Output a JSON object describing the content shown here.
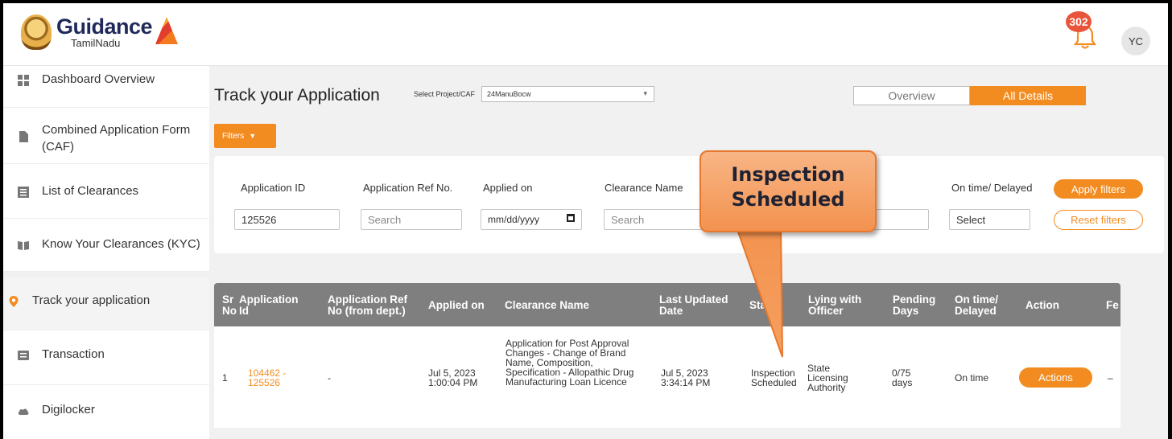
{
  "header": {
    "logo_main": "Guidance",
    "logo_sub": "TamilNadu",
    "notification_count": "302",
    "avatar_initials": "YC"
  },
  "sidebar": {
    "items": [
      {
        "label": "Dashboard Overview",
        "icon": "dashboard-icon"
      },
      {
        "label": "Combined Application Form (CAF)",
        "icon": "document-icon"
      },
      {
        "label": "List of Clearances",
        "icon": "list-icon"
      },
      {
        "label": "Know Your Clearances (KYC)",
        "icon": "book-icon"
      },
      {
        "label": "Track your application",
        "icon": "location-pin-icon"
      },
      {
        "label": "Transaction",
        "icon": "transaction-icon"
      },
      {
        "label": "Digilocker",
        "icon": "cloud-icon"
      }
    ]
  },
  "main": {
    "title": "Track your Application",
    "project_label": "Select Project/CAF",
    "project_value": "24ManuBocw",
    "tabs": {
      "overview": "Overview",
      "all_details": "All Details"
    },
    "filters_label": "Filters"
  },
  "filters": {
    "application_id_label": "Application ID",
    "application_id_value": "125526",
    "ref_no_label": "Application Ref No.",
    "ref_no_placeholder": "Search",
    "applied_on_label": "Applied on",
    "applied_on_placeholder": "mm/dd/yyyy",
    "clearance_name_label": "Clearance Name",
    "clearance_name_placeholder": "Search",
    "ontime_label": "On time/ Delayed",
    "ontime_value": "Select",
    "apply_label": "Apply filters",
    "reset_label": "Reset filters"
  },
  "table": {
    "headers": {
      "sr": "Sr No",
      "app_id": "Application Id",
      "app_ref": "Application Ref No (from dept.)",
      "applied_on": "Applied on",
      "clearance": "Clearance Name",
      "last_updated": "Last Updated Date",
      "status": "Status",
      "lying": "Lying with Officer",
      "pending": "Pending Days",
      "ontime": "On time/ Delayed",
      "action": "Action",
      "fee": "Fe"
    },
    "row": {
      "sr": "1",
      "app_id": "104462 - 125526",
      "app_ref": "-",
      "applied_on": "Jul 5, 2023 1:00:04 PM",
      "clearance": "Application for Post Approval Changes - Change of Brand Name, Composition, Specification - Allopathic Drug Manufacturing Loan Licence",
      "last_updated": "Jul 5, 2023 3:34:14 PM",
      "status": "Inspection Scheduled",
      "lying": "State Licensing Authority",
      "pending": "0/75 days",
      "ontime": "On time",
      "action": "Actions",
      "fee": "–"
    }
  },
  "callout": {
    "line1": "Inspection",
    "line2": "Scheduled"
  },
  "colors": {
    "accent": "#f28c20",
    "table_header": "#7f7f7f",
    "badge": "#e8553a",
    "callout": "#f3924f"
  }
}
